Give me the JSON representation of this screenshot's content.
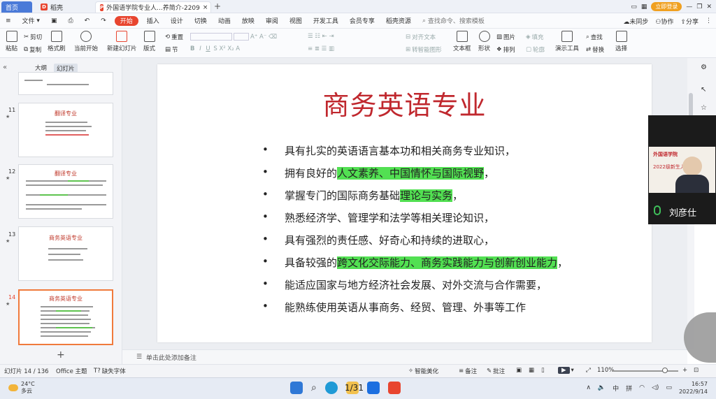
{
  "titlebar": {
    "tabs": [
      {
        "label": "首页"
      },
      {
        "label": "稻壳"
      },
      {
        "label": "外国语学院专业人...养简介-2209"
      }
    ],
    "login_label": "立即登录"
  },
  "menubar": {
    "file_label": "文件",
    "items": [
      "开始",
      "插入",
      "设计",
      "切换",
      "动画",
      "放映",
      "审阅",
      "视图",
      "开发工具",
      "会员专享",
      "稻壳资源"
    ],
    "search_placeholder": "查找命令、搜索模板",
    "right_items": [
      "未同步",
      "协作",
      "分享"
    ]
  },
  "ribbon": {
    "paste": "粘贴",
    "cut": "剪切",
    "copy": "复制",
    "format_painter": "格式刷",
    "play_from_current": "当前开始",
    "new_slide": "新建幻灯片",
    "layout": "版式",
    "section": "节",
    "reset": "重置",
    "align_text": "对齐文本",
    "convert_smartart": "转智能图形",
    "textbox": "文本框",
    "shape": "形状",
    "arrange": "排列",
    "picture": "图片",
    "fill": "填充",
    "outline": "轮廓",
    "present_tools": "演示工具",
    "find": "查找",
    "replace": "替换",
    "select": "选择"
  },
  "leftpanel": {
    "tab_outline": "大纲",
    "tab_slides": "幻灯片",
    "thumbnails": [
      {
        "num": "11",
        "title": "翻译专业"
      },
      {
        "num": "12",
        "title": "翻译专业"
      },
      {
        "num": "13",
        "title": "商务英语专业"
      },
      {
        "num": "14",
        "title": "商务英语专业"
      }
    ]
  },
  "slide": {
    "title": "商务英语专业",
    "bullets": [
      {
        "pre": "具有扎实的英语语言基本功和相关商务专业知识，",
        "hl": "",
        "post": ""
      },
      {
        "pre": "拥有良好的",
        "hl": "人文素养、中国情怀与国际视野",
        "post": "，"
      },
      {
        "pre": "掌握专门的国际商务基础",
        "hl": "理论与实务",
        "post": "，"
      },
      {
        "pre": "熟悉经济学、管理学和法学等相关理论知识，",
        "hl": "",
        "post": ""
      },
      {
        "pre": "具有强烈的责任感、好奇心和持续的进取心，",
        "hl": "",
        "post": ""
      },
      {
        "pre": "具备较强的",
        "hl": "跨文化交际能力、商务实践能力与创新创业能力",
        "post": "，"
      },
      {
        "pre": "能适应国家与地方经济社会发展、对外交流与合作需要，",
        "hl": "",
        "post": ""
      },
      {
        "pre": "能熟练使用英语从事商务、经贸、管理、外事等工作",
        "hl": "",
        "post": ""
      }
    ]
  },
  "video": {
    "school": "外国语学院",
    "banner": "2022级新生入",
    "speaker": "刘彦仕"
  },
  "notes": {
    "placeholder": "单击此处添加备注"
  },
  "statusbar": {
    "slide_counter": "幻灯片 14 / 136",
    "theme": "Office 主题",
    "missing_font": "缺失字体",
    "smart_beautify": "智能美化",
    "notes": "备注",
    "comments": "批注",
    "zoom": "110%"
  },
  "taskbar": {
    "temp": "24°C",
    "weather": "多云",
    "page_indicator": "1/31",
    "ime_lang": "中",
    "ime_mode": "拼",
    "time": "16:57",
    "date": "2022/9/14"
  },
  "colors": {
    "accent": "#e8452f",
    "title_red": "#c0282e",
    "highlight": "#52e052"
  }
}
